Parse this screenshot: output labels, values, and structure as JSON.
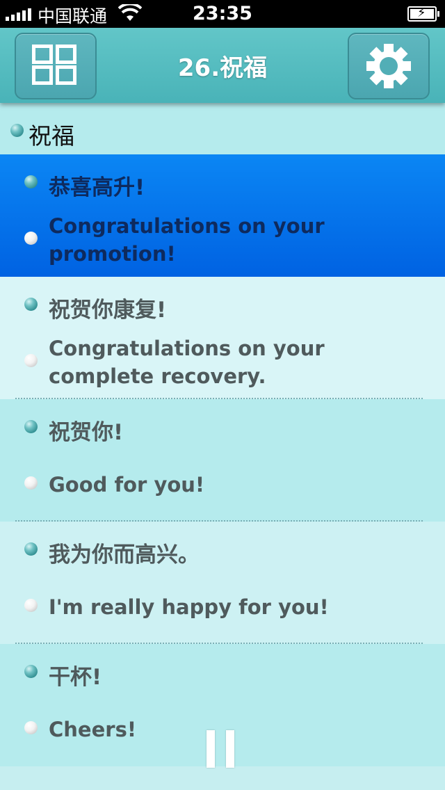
{
  "status_bar": {
    "carrier": "中国联通",
    "time": "23:35"
  },
  "header": {
    "title": "26.祝福",
    "left_icon": "grid-menu-icon",
    "right_icon": "gear-icon"
  },
  "section": {
    "label": "祝福"
  },
  "items": [
    {
      "zh": "恭喜高升!",
      "en": "Congratulations on your promotion!"
    },
    {
      "zh": "祝贺你康复!",
      "en": "Congratulations on your complete recovery."
    },
    {
      "zh": "祝贺你!",
      "en": "Good for you!"
    },
    {
      "zh": "我为你而高兴。",
      "en": "I'm really happy for you!"
    },
    {
      "zh": "干杯!",
      "en": "Cheers!"
    }
  ],
  "selected_index": 0,
  "colors": {
    "header": "#55bdc1",
    "selected_row": "#0a7af0",
    "row_alt": "#b5ebed",
    "row_plain": "#cdf1f3"
  }
}
